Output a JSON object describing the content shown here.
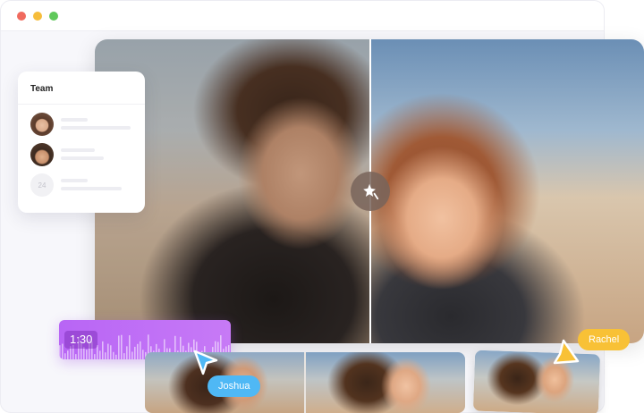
{
  "window": {
    "controls": [
      {
        "name": "close",
        "color": "#f06a5e"
      },
      {
        "name": "minimize",
        "color": "#f6bd3b"
      },
      {
        "name": "maximize",
        "color": "#5fc85a"
      }
    ]
  },
  "comparison": {
    "center_icon": "magic-wand-icon"
  },
  "team_panel": {
    "title": "Team",
    "more_count": "24"
  },
  "audio": {
    "time": "1:30",
    "color": "#c06ef5"
  },
  "collaborators": {
    "joshua": {
      "name": "Joshua",
      "color": "#4fb8f5"
    },
    "rachel": {
      "name": "Rachel",
      "color": "#f8c136"
    }
  }
}
